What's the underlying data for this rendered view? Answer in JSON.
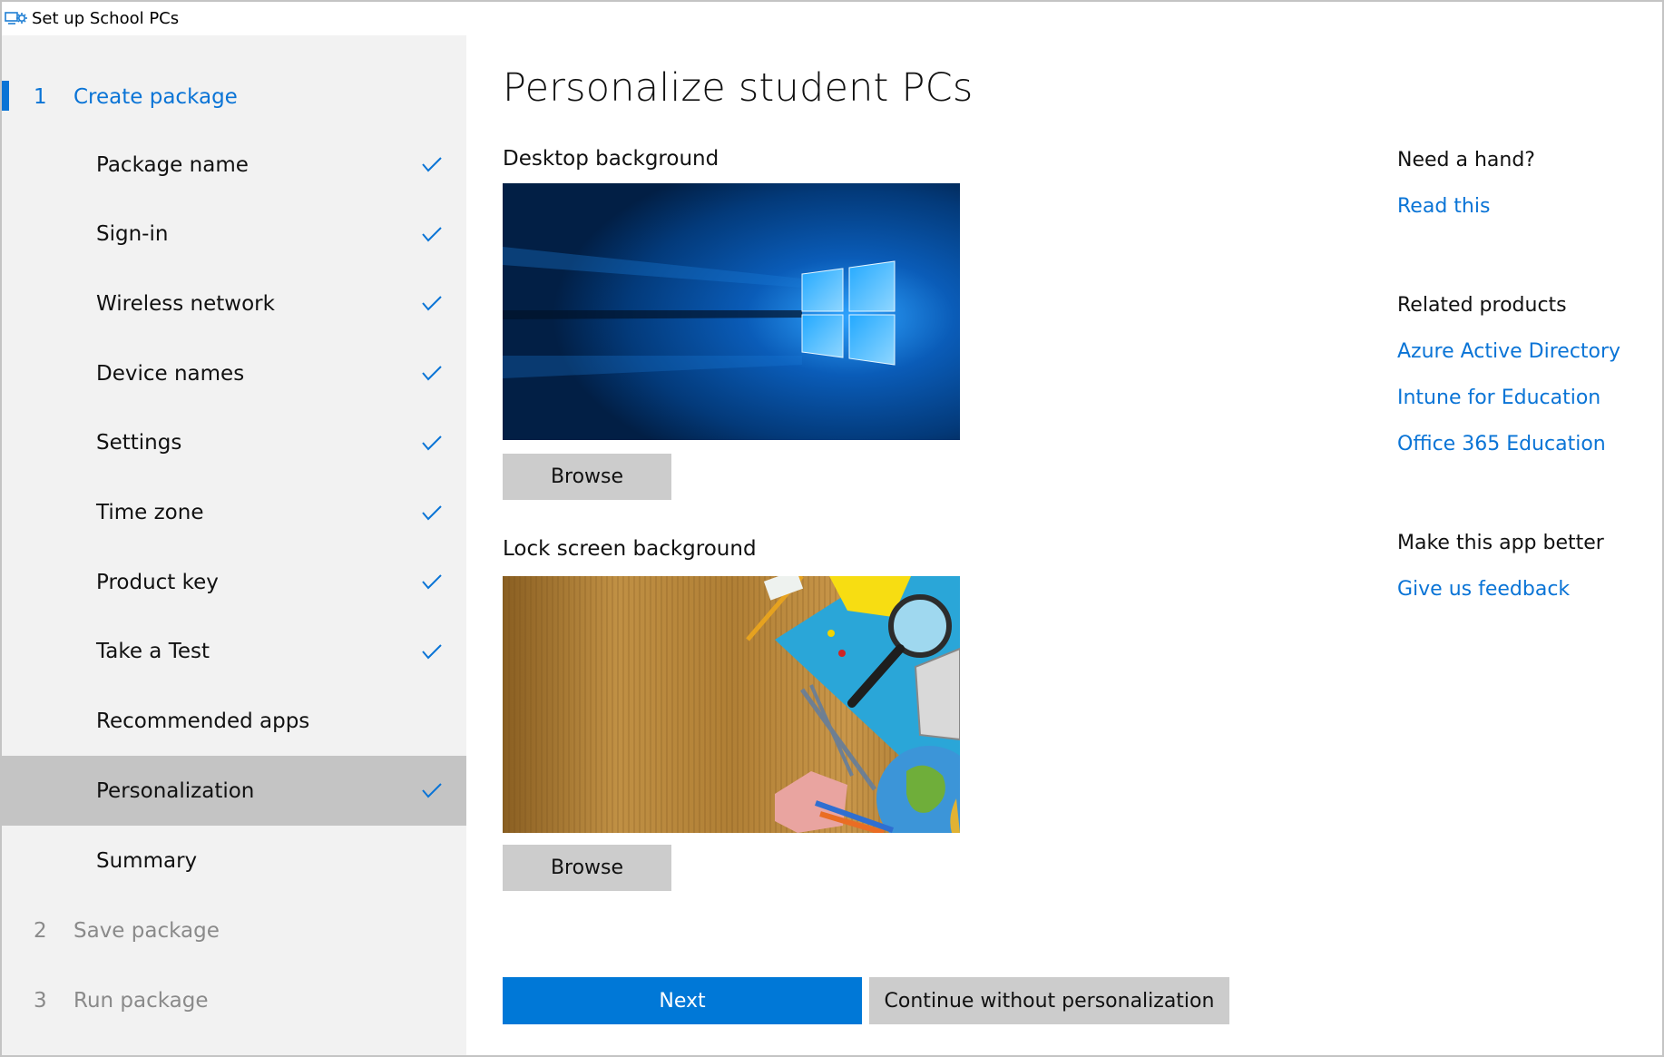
{
  "window": {
    "title": "Set up School PCs",
    "icon": "school-pc-setup-icon"
  },
  "colors": {
    "accent": "#0078d7",
    "link": "#0a74d6",
    "sidebar_bg": "#f2f2f2",
    "selected_bg": "#c4c4c4",
    "button_gray": "#cccccc"
  },
  "sidebar": {
    "steps": [
      {
        "number": "1",
        "label": "Create package",
        "state": "active"
      },
      {
        "number": "2",
        "label": "Save package",
        "state": "disabled"
      },
      {
        "number": "3",
        "label": "Run package",
        "state": "disabled"
      }
    ],
    "substeps": [
      {
        "label": "Package name",
        "completed": true,
        "selected": false
      },
      {
        "label": "Sign-in",
        "completed": true,
        "selected": false
      },
      {
        "label": "Wireless network",
        "completed": true,
        "selected": false
      },
      {
        "label": "Device names",
        "completed": true,
        "selected": false
      },
      {
        "label": "Settings",
        "completed": true,
        "selected": false
      },
      {
        "label": "Time zone",
        "completed": true,
        "selected": false
      },
      {
        "label": "Product key",
        "completed": true,
        "selected": false
      },
      {
        "label": "Take a Test",
        "completed": true,
        "selected": false
      },
      {
        "label": "Recommended apps",
        "completed": false,
        "selected": false
      },
      {
        "label": "Personalization",
        "completed": true,
        "selected": true
      },
      {
        "label": "Summary",
        "completed": false,
        "selected": false
      }
    ]
  },
  "main": {
    "title": "Personalize student PCs",
    "desktop": {
      "label": "Desktop background",
      "image": "windows-10-hero-wallpaper",
      "browse_label": "Browse"
    },
    "lockscreen": {
      "label": "Lock screen background",
      "image": "school-supplies-on-wooden-desk",
      "browse_label": "Browse"
    },
    "next_label": "Next",
    "skip_label": "Continue without personalization"
  },
  "aside": {
    "help_heading": "Need a hand?",
    "help_link": "Read this",
    "related_heading": "Related products",
    "related_links": [
      "Azure Active Directory",
      "Intune for Education",
      "Office 365 Education"
    ],
    "feedback_heading": "Make this app better",
    "feedback_link": "Give us feedback"
  }
}
